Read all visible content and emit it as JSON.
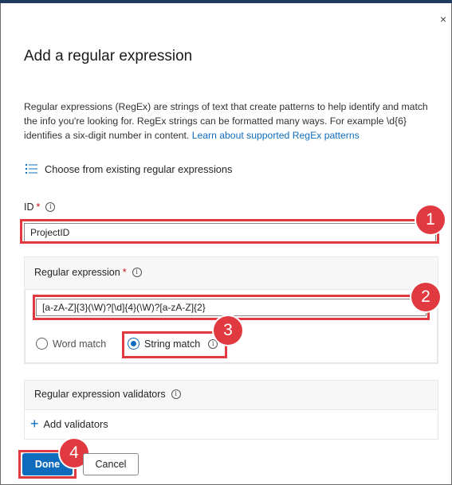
{
  "dialog": {
    "title": "Add a regular expression",
    "close_glyph": "×",
    "description": "Regular expressions (RegEx) are strings of text that create patterns to help identify and match the info you're looking for. RegEx strings can be formatted many ways. For example \\d{6} identifies a six-digit number in content.",
    "learn_link": "Learn about supported RegEx patterns",
    "choose_existing": "Choose from existing regular expressions"
  },
  "id_field": {
    "label": "ID",
    "required_mark": "*",
    "info_glyph": "i",
    "value": "ProjectID"
  },
  "regex_field": {
    "label": "Regular expression",
    "required_mark": "*",
    "info_glyph": "i",
    "value": "[a-zA-Z]{3}(\\W)?[\\d]{4}(\\W)?[a-zA-Z]{2}"
  },
  "match_options": {
    "word_match": "Word match",
    "string_match": "String match",
    "selected": "String match",
    "info_glyph": "i"
  },
  "validators": {
    "label": "Regular expression validators",
    "info_glyph": "i",
    "add_label": "Add validators",
    "plus_glyph": "+"
  },
  "footer": {
    "done_label": "Done",
    "cancel_label": "Cancel"
  },
  "callouts": [
    "1",
    "2",
    "3",
    "4"
  ],
  "colors": {
    "accent": "#0f6cbd",
    "callout": "#e0393f",
    "required": "#c50f1f"
  }
}
